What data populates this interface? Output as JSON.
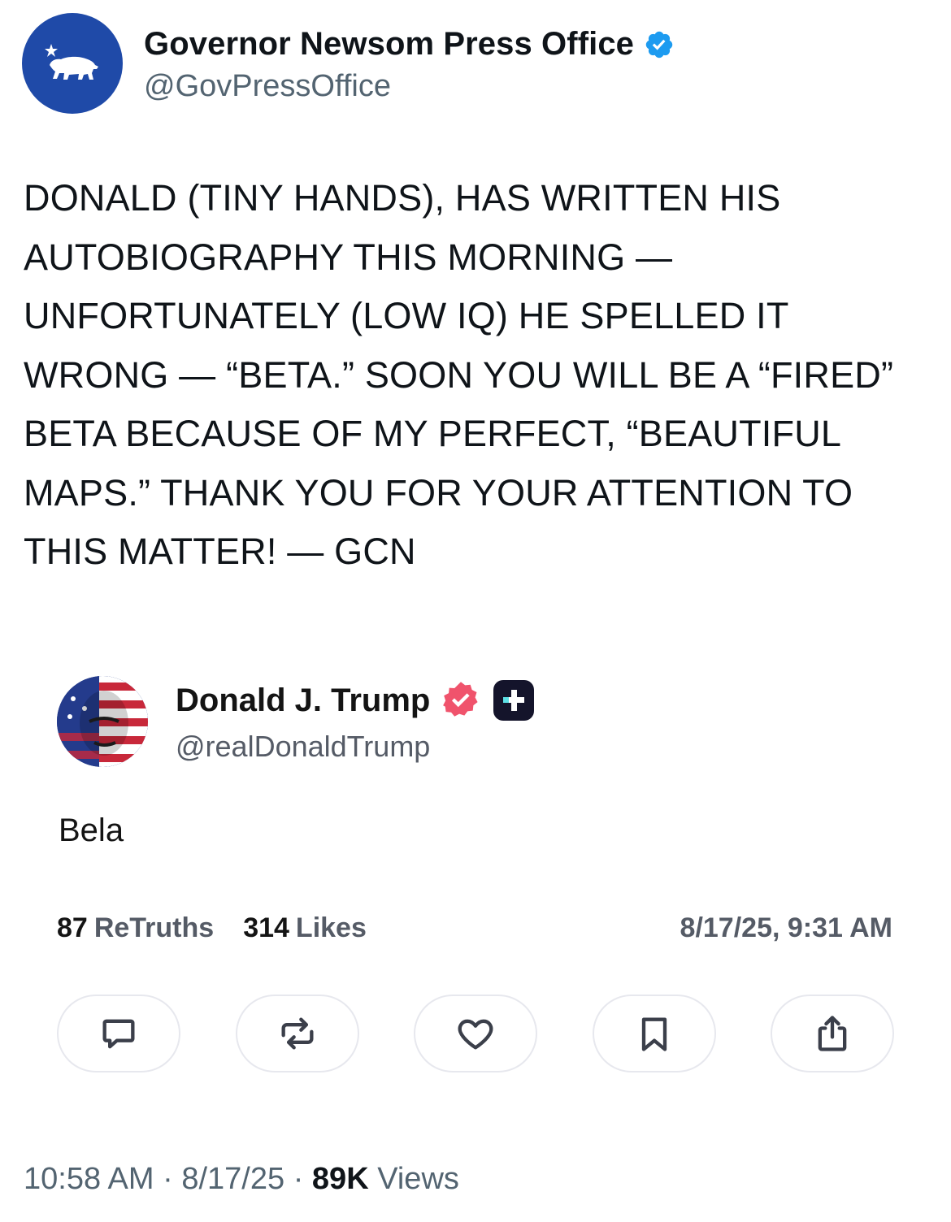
{
  "header": {
    "display_name": "Governor Newsom Press Office",
    "handle": "@GovPressOffice",
    "verified_color": "#1d9bf0",
    "avatar_icon": "california-bear-icon",
    "avatar_color": "#1f4aa8"
  },
  "post": {
    "lines": [
      "DONALD (TINY HANDS), HAS WRITTEN HIS",
      "AUTOBIOGRAPHY THIS MORNING —",
      "UNFORTUNATELY (LOW IQ) HE SPELLED IT",
      "WRONG — “BETA.” SOON YOU WILL BE A “FIRED”",
      "BETA BECAUSE OF MY PERFECT, “BEAUTIFUL",
      "MAPS.” THANK YOU FOR YOUR ATTENTION TO",
      "THIS MATTER! — GCN"
    ]
  },
  "embed": {
    "display_name": "Donald J. Trump",
    "handle": "@realDonaldTrump",
    "badge_color": "#f0536c",
    "body": "Bela",
    "retruths_count": "87",
    "retruths_label": "ReTruths",
    "likes_count": "314",
    "likes_label": "Likes",
    "date": "8/17/25, 9:31 AM",
    "actions": [
      "reply-icon",
      "retruth-icon",
      "like-icon",
      "bookmark-icon",
      "share-icon"
    ]
  },
  "footer": {
    "time": "10:58 AM",
    "sep1": " · ",
    "date": "8/17/25",
    "sep2": " · ",
    "views_count": "89K",
    "views_label": "Views"
  }
}
